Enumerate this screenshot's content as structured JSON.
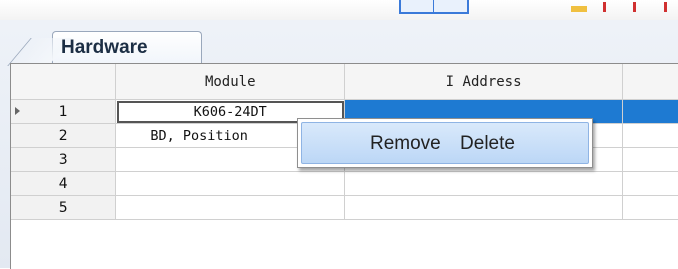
{
  "tab": {
    "label": "Hardware"
  },
  "grid": {
    "columns": [
      "",
      "Module",
      "I Address",
      ""
    ],
    "rows": [
      {
        "num": "1",
        "module": "K606-24DT",
        "address": "",
        "current": true
      },
      {
        "num": "2",
        "module": "BD, Position",
        "address": ""
      },
      {
        "num": "3",
        "module": "",
        "address": ""
      },
      {
        "num": "4",
        "module": "",
        "address": ""
      },
      {
        "num": "5",
        "module": "",
        "address": ""
      }
    ]
  },
  "context_menu": {
    "item_label": "Remove Delete"
  },
  "colors": {
    "selection": "#1e7ad2",
    "menu_highlight": "#bcd7f6"
  }
}
